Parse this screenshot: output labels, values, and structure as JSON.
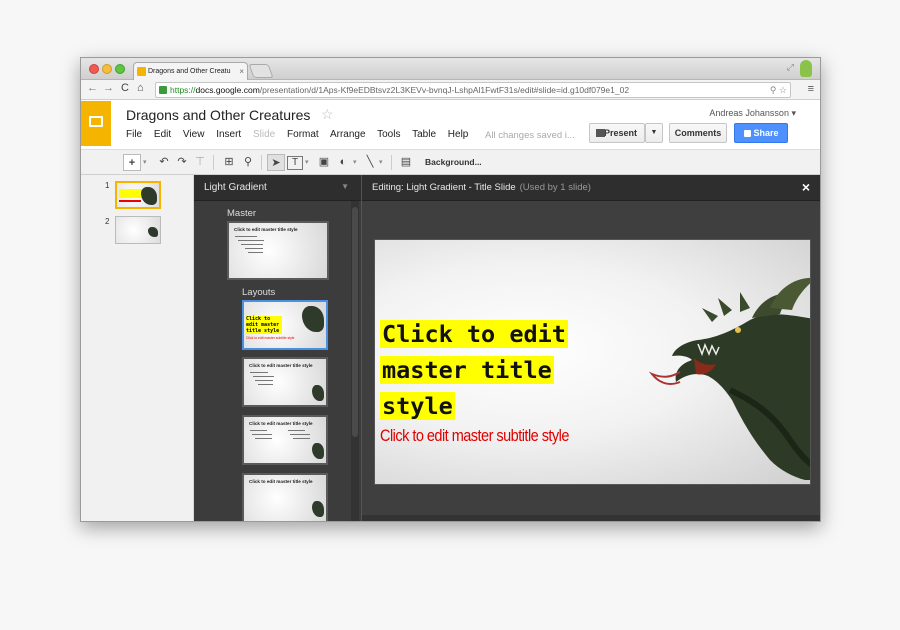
{
  "browser": {
    "tab_title": "Dragons and Other Creatu",
    "url_scheme": "https://",
    "url_host": "docs.google.com",
    "url_path": "/presentation/d/1Aps-Kf9eEDBtsvz2L3KEVv-bvnqJ-LshpAl1FwtF31s/edit#slide=id.g10df079e1_02"
  },
  "app": {
    "doc_title": "Dragons and Other Creatures",
    "menu": [
      "File",
      "Edit",
      "View",
      "Insert",
      "Slide",
      "Format",
      "Arrange",
      "Tools",
      "Table",
      "Help"
    ],
    "saved_status": "All changes saved i...",
    "user": "Andreas Johansson",
    "present_label": "Present",
    "comments_label": "Comments",
    "share_label": "Share"
  },
  "toolbar": {
    "background_label": "Background..."
  },
  "filmstrip": {
    "slides": [
      {
        "num": "1",
        "selected": true
      },
      {
        "num": "2",
        "selected": false
      }
    ]
  },
  "master_panel": {
    "theme_name": "Light Gradient",
    "master_label": "Master",
    "layouts_label": "Layouts",
    "master_thumb_title": "Click to edit master title style",
    "layout_thumb_title": "Click to edit master title style",
    "layout_thumb_subtitle": "Click to edit master subtitle style"
  },
  "editor": {
    "title": "Editing: Light Gradient - Title Slide",
    "used": "(Used by 1 slide)",
    "slide_title_lines": [
      "Click to edit",
      "master title",
      "style"
    ],
    "slide_subtitle": "Click to edit master subtitle style"
  },
  "colors": {
    "slides_yellow": "#f4b400",
    "share_blue": "#4d90fe",
    "title_highlight": "#ffff00",
    "subtitle_red": "#e00000"
  }
}
